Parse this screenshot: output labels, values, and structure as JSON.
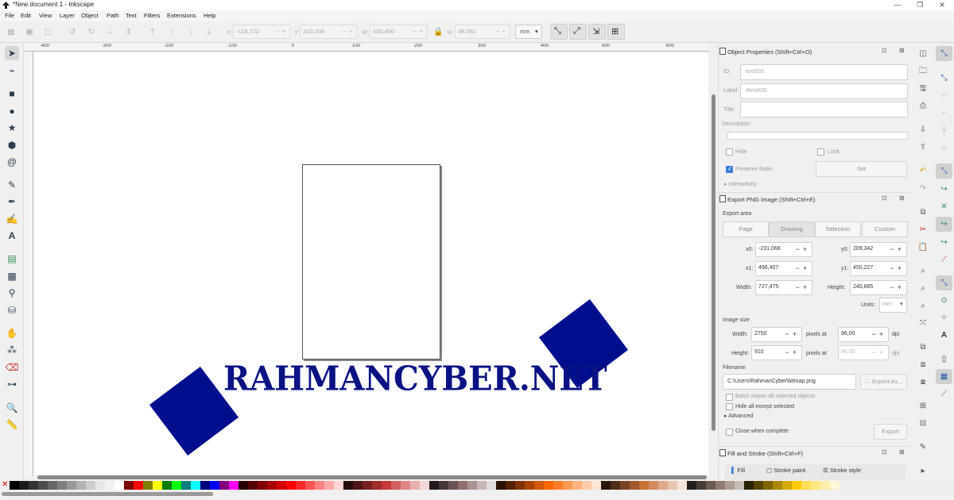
{
  "window": {
    "title": "*New document 1 - Inkscape",
    "controls": [
      "—",
      "❐",
      "✕"
    ]
  },
  "menu": [
    "File",
    "Edit",
    "View",
    "Layer",
    "Object",
    "Path",
    "Text",
    "Filters",
    "Extensions",
    "Help"
  ],
  "toolbar": {
    "x_label": "X:",
    "x_value": "-118,722",
    "y_label": "Y:",
    "y_value": "310,208",
    "w_label": "W:",
    "w_value": "500,450",
    "h_label": "H:",
    "h_value": "38,592",
    "units": "mm"
  },
  "ruler_labels": [
    "-400",
    "-300",
    "-200",
    "-100",
    "0",
    "100",
    "200",
    "300",
    "400",
    "500",
    "600"
  ],
  "canvas": {
    "logo_text": "RAHMANCYBER.NET",
    "shape_color": "#000d8c"
  },
  "object_properties": {
    "title": "Object Properties (Shift+Ctrl+O)",
    "id_label": "ID:",
    "id_value": "text835",
    "label_label": "Label:",
    "label_value": "#text835",
    "title_label": "Title:",
    "title_value": "",
    "description_label": "Description:",
    "hide_label": "Hide",
    "lock_label": "Lock",
    "preserve_ratio_label": "Preserve Ratio",
    "set_button": "Set",
    "interactivity_label": "Interactivity"
  },
  "export_png": {
    "title": "Export PNG Image (Shift+Ctrl+E)",
    "export_area_label": "Export area",
    "area_tabs": [
      "Page",
      "Drawing",
      "Selection",
      "Custom"
    ],
    "active_tab": "Drawing",
    "x0_label": "x0:",
    "x0_value": "-231,068",
    "y0_label": "y0:",
    "y0_value": "209,342",
    "x1_label": "x1:",
    "x1_value": "496,407",
    "y1_label": "y1:",
    "y1_value": "450,227",
    "width_label": "Width:",
    "width_value": "727,475",
    "height_label": "Height:",
    "height_value": "240,885",
    "units_label": "Units:",
    "units_value": "mm",
    "image_size_label": "Image size",
    "img_width_label": "Width:",
    "img_width_value": "2750",
    "img_height_label": "Height:",
    "img_height_value": "910",
    "pixels_at_label": "pixels at",
    "dpi_value": "96,00",
    "dpi_value_2": "96,00",
    "dpi_label": "dpi",
    "filename_label": "Filename",
    "filename_value": "C:\\Users\\RahmanCyber\\bitmap.png",
    "export_as_button": "Export As...",
    "batch_label": "Batch export all selected objects",
    "hide_except_label": "Hide all except selected",
    "advanced_label": "Advanced",
    "close_when_complete_label": "Close when complete",
    "export_button": "Export"
  },
  "fill_stroke": {
    "title": "Fill and Stroke (Shift+Ctrl+F)",
    "tabs": [
      "Fill",
      "Stroke paint",
      "Stroke style"
    ]
  },
  "palette": [
    "#000000",
    "#1a1a1a",
    "#333333",
    "#4d4d4d",
    "#666666",
    "#808080",
    "#999999",
    "#b3b3b3",
    "#cccccc",
    "#e6e6e6",
    "#f2f2f2",
    "#ffffff",
    "#800000",
    "#ff0000",
    "#808000",
    "#ffff00",
    "#008000",
    "#00ff00",
    "#008080",
    "#00ffff",
    "#000080",
    "#0000ff",
    "#800080",
    "#ff00ff",
    "#2b0000",
    "#550000",
    "#800000",
    "#aa0000",
    "#d40000",
    "#ff0000",
    "#ff2a2a",
    "#ff5555",
    "#ff8080",
    "#ffaaaa",
    "#ffd5d5",
    "#280b0b",
    "#501616",
    "#782121",
    "#a02c2c",
    "#c83737",
    "#d35f5f",
    "#de8787",
    "#e9afaf",
    "#f4d7d7",
    "#241c1c",
    "#483737",
    "#6c5353",
    "#916f6f",
    "#ac9393",
    "#c8b7b7",
    "#e3dbdb",
    "#2b1100",
    "#552200",
    "#803300",
    "#aa4400",
    "#d45500",
    "#ff6600",
    "#ff7f2a",
    "#ff9955",
    "#ffb380",
    "#ffccaa",
    "#ffe6d5",
    "#28170b",
    "#502d16",
    "#784421",
    "#a05a2c",
    "#c87137",
    "#d38d5f",
    "#deaa87",
    "#e9c6af",
    "#f4e3d7",
    "#241f1c",
    "#483e37",
    "#6c5d53",
    "#917c6f",
    "#ac9d93",
    "#c8beb7",
    "#2b2200",
    "#554400",
    "#806600",
    "#aa8800",
    "#d4aa00",
    "#ffcc00",
    "#ffdd55",
    "#ffe680",
    "#ffeeaa",
    "#fff6d5"
  ]
}
